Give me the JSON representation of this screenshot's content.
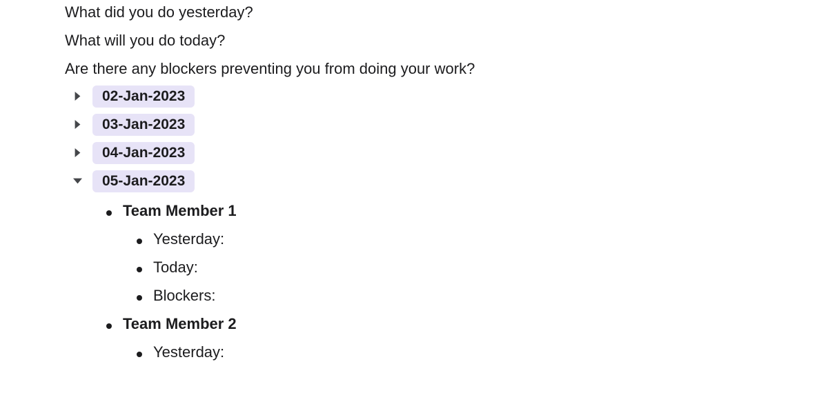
{
  "questions": [
    "What did you do yesterday?",
    "What will you do today?",
    "Are there any blockers preventing you from doing your work?"
  ],
  "dates": [
    {
      "label": "02-Jan-2023",
      "expanded": false
    },
    {
      "label": "03-Jan-2023",
      "expanded": false
    },
    {
      "label": "04-Jan-2023",
      "expanded": false
    },
    {
      "label": "05-Jan-2023",
      "expanded": true
    }
  ],
  "members": [
    {
      "name": "Team Member 1",
      "fields": [
        "Yesterday:",
        "Today:",
        "Blockers:"
      ]
    },
    {
      "name": "Team Member 2",
      "fields": [
        "Yesterday:"
      ]
    }
  ]
}
